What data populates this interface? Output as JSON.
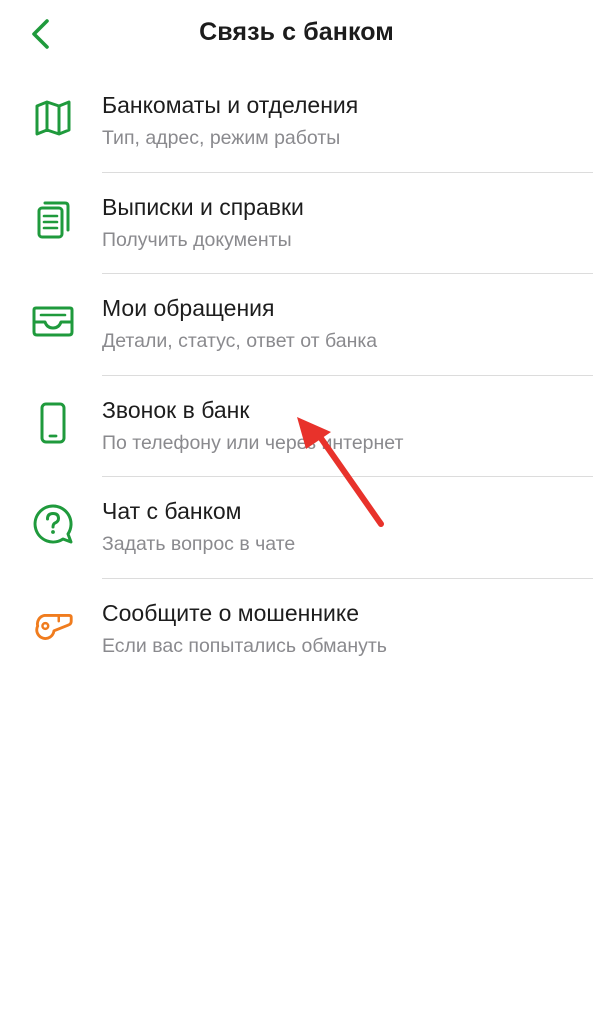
{
  "header": {
    "title": "Связь с банком",
    "back_icon": "chevron-left-icon"
  },
  "colors": {
    "accent_green": "#1f9a3c",
    "fraud_orange": "#f07c1e",
    "annotation_red": "#e8322b"
  },
  "menu": {
    "items": [
      {
        "label": "Банкоматы и отделения",
        "subtitle": "Тип, адрес, режим работы",
        "icon": "map-icon"
      },
      {
        "label": "Выписки и справки",
        "subtitle": "Получить документы",
        "icon": "documents-icon"
      },
      {
        "label": "Мои обращения",
        "subtitle": "Детали, статус, ответ от банка",
        "icon": "inbox-icon"
      },
      {
        "label": "Звонок в банк",
        "subtitle": "По телефону или через интернет",
        "icon": "phone-icon"
      },
      {
        "label": "Чат с банком",
        "subtitle": "Задать вопрос в чате",
        "icon": "chat-question-icon"
      },
      {
        "label": "Сообщите о мошеннике",
        "subtitle": "Если вас попытались обмануть",
        "icon": "whistle-icon"
      }
    ]
  },
  "annotation": {
    "icon": "red-arrow-icon",
    "points_to": "Звонок в банк"
  }
}
